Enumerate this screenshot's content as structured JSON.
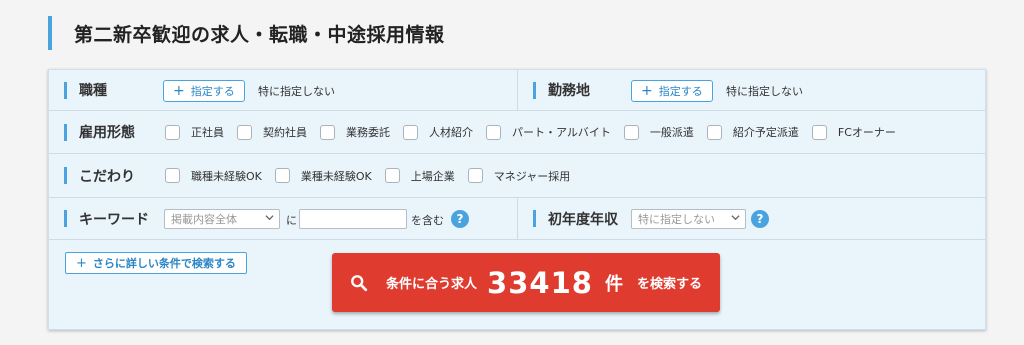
{
  "header": {
    "title": "第二新卒歓迎の求人・転職・中途採用情報"
  },
  "form": {
    "occupation": {
      "label": "職種",
      "button": "指定する",
      "current": "特に指定しない"
    },
    "location": {
      "label": "勤務地",
      "button": "指定する",
      "current": "特に指定しない"
    },
    "employment": {
      "label": "雇用形態",
      "options": [
        "正社員",
        "契約社員",
        "業務委託",
        "人材紹介",
        "パート・アルバイト",
        "一般派遣",
        "紹介予定派遣",
        "FCオーナー"
      ]
    },
    "preferences": {
      "label": "こだわり",
      "options": [
        "職種未経験OK",
        "業種未経験OK",
        "上場企業",
        "マネジャー採用"
      ]
    },
    "keyword": {
      "label": "キーワード",
      "scope_select": "掲載内容全体",
      "connector": "に",
      "value": "",
      "suffix": "を含む",
      "help": "?"
    },
    "salary": {
      "label": "初年度年収",
      "select": "特に指定しない",
      "help": "?"
    },
    "more_conditions": "さらに詳しい条件で検索する",
    "search": {
      "prefix": "条件に合う求人",
      "count": "33418",
      "unit": "件",
      "suffix": "を検索する"
    }
  },
  "colors": {
    "accent": "#4aa3df",
    "search_button": "#e03b2f",
    "panel_bg": "#e9f4fb"
  }
}
